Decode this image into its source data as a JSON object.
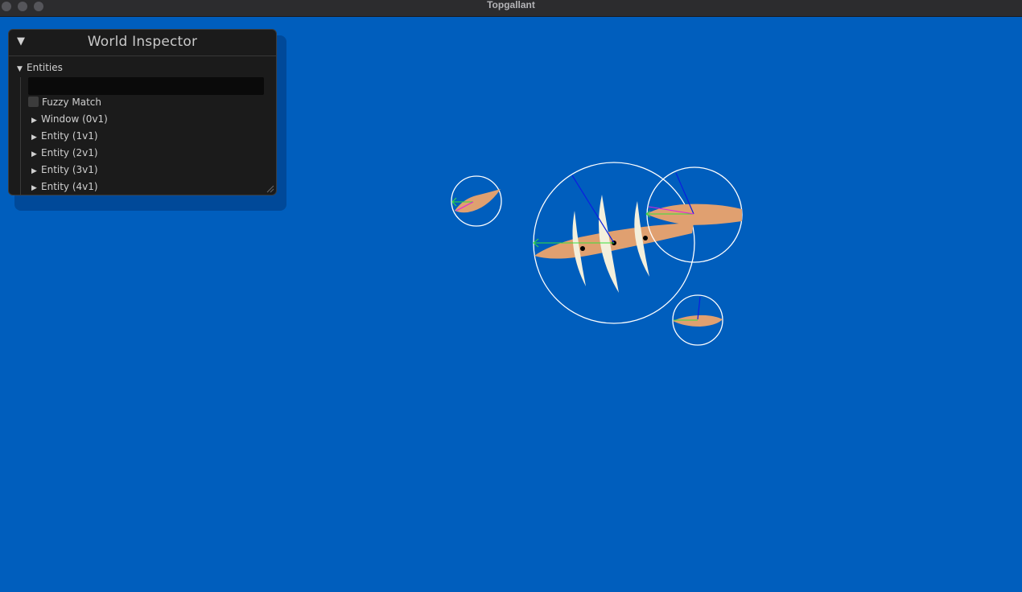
{
  "window": {
    "title": "Topgallant"
  },
  "inspector": {
    "title": "World Inspector",
    "entities_header": "Entities",
    "search": {
      "value": "",
      "placeholder": ""
    },
    "fuzzy_match_label": "Fuzzy Match",
    "fuzzy_match_checked": false,
    "items": [
      {
        "label": "Window (0v1)"
      },
      {
        "label": "Entity (1v1)"
      },
      {
        "label": "Entity (2v1)"
      },
      {
        "label": "Entity (3v1)"
      },
      {
        "label": "Entity (4v1)"
      }
    ]
  },
  "colors": {
    "sea": "#005ebd",
    "hull": "#e0a070",
    "sail": "#f3efdc",
    "collider_outline": "#ffffff",
    "forward_vector": "#39e03b",
    "up_vector": "#0b1fe0",
    "steer_vector": "#e020e0"
  },
  "icons": {
    "collapse": "triangle-down-icon",
    "expand": "triangle-right-icon",
    "resize": "resize-grip-icon"
  }
}
